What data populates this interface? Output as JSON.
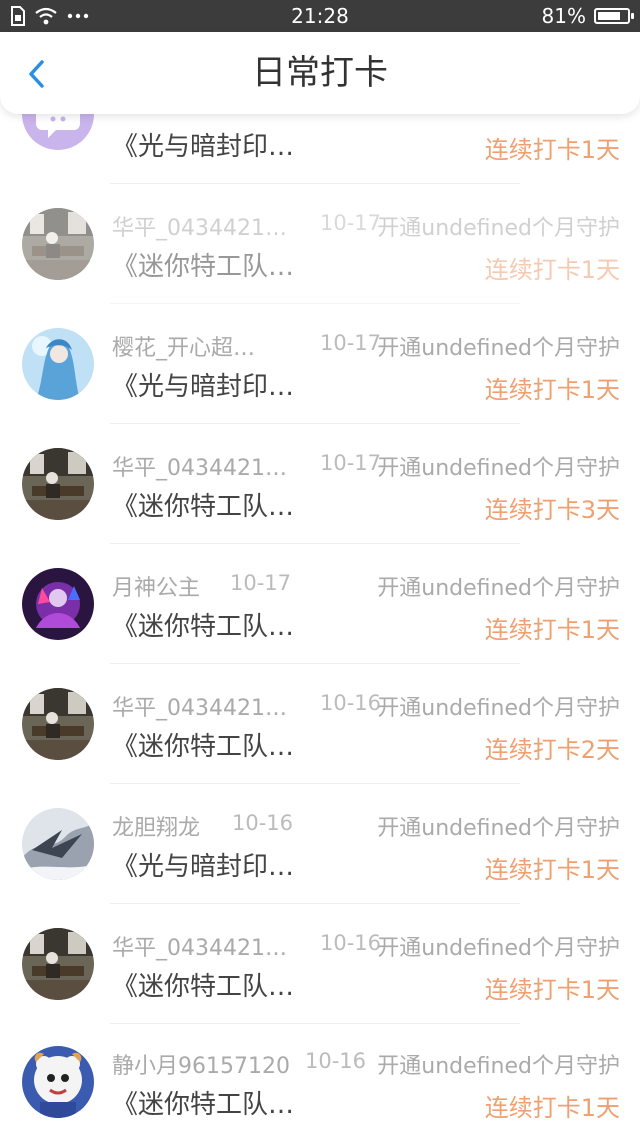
{
  "status_bar": {
    "time": "21:28",
    "battery": "81%",
    "battery_level": 0.81,
    "icons": [
      "sim-card-icon",
      "wifi-icon",
      "more-dots-icon"
    ]
  },
  "header": {
    "title": "日常打卡",
    "back_icon": "chevron-left-icon"
  },
  "colors": {
    "accent_blue": "#2a8fe0",
    "streak_orange": "#f0a070",
    "status_bar_bg": "#3c3c3c"
  },
  "rows": [
    {
      "name": "",
      "date": "",
      "guard": "",
      "book": "《光与暗封印…",
      "streak": "连续打卡1天",
      "avatar": "purple-chat-avatar"
    },
    {
      "name": "华平_0434421…",
      "date": "10-17",
      "guard": "开通undefined个月守护",
      "book": "《迷你特工队…",
      "streak": "连续打卡1天",
      "avatar": "room-photo-avatar"
    },
    {
      "name": "樱花_开心超…",
      "date": "10-17",
      "guard": "开通undefined个月守护",
      "book": "《光与暗封印…",
      "streak": "连续打卡1天",
      "avatar": "anime-blue-avatar"
    },
    {
      "name": "华平_0434421…",
      "date": "10-17",
      "guard": "开通undefined个月守护",
      "book": "《迷你特工队…",
      "streak": "连续打卡3天",
      "avatar": "room-photo-avatar"
    },
    {
      "name": "月神公主",
      "date": "10-17",
      "guard": "开通undefined个月守护",
      "book": "《迷你特工队…",
      "streak": "连续打卡1天",
      "avatar": "dark-purple-avatar"
    },
    {
      "name": "华平_0434421…",
      "date": "10-16",
      "guard": "开通undefined个月守护",
      "book": "《迷你特工队…",
      "streak": "连续打卡2天",
      "avatar": "room-photo-avatar"
    },
    {
      "name": "龙胆翔龙",
      "date": "10-16",
      "guard": "开通undefined个月守护",
      "book": "《光与暗封印…",
      "streak": "连续打卡1天",
      "avatar": "grey-dragon-avatar"
    },
    {
      "name": "华平_0434421…",
      "date": "10-16",
      "guard": "开通undefined个月守护",
      "book": "《迷你特工队…",
      "streak": "连续打卡1天",
      "avatar": "room-photo-avatar"
    },
    {
      "name": "静小月96157120",
      "date": "10-16",
      "guard": "开通undefined个月守护",
      "book": "《迷你特工队…",
      "streak": "连续打卡1天",
      "avatar": "cartoon-sheep-avatar"
    }
  ]
}
